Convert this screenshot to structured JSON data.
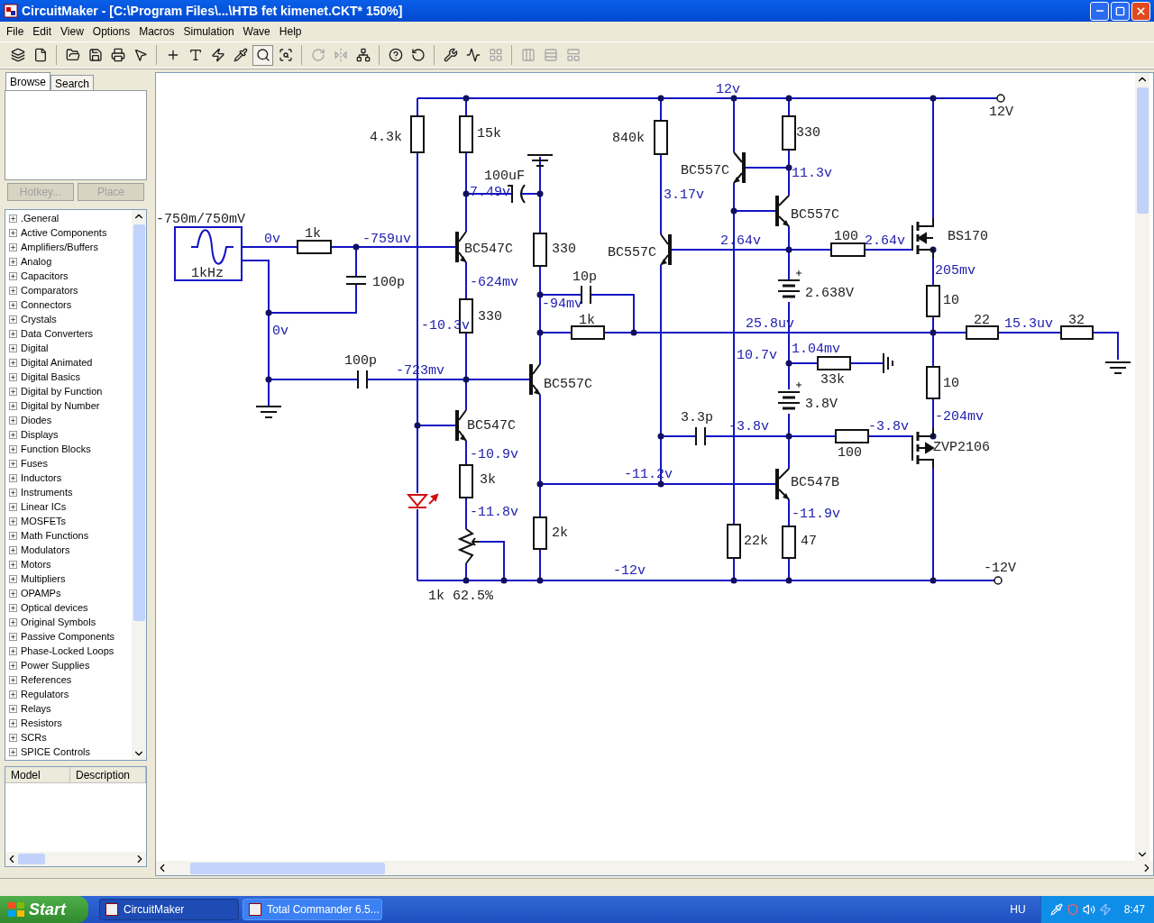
{
  "window": {
    "title": "CircuitMaker - [C:\\Program Files\\...\\HTB fet kimenet.CKT* 150%]"
  },
  "menu": [
    "File",
    "Edit",
    "View",
    "Options",
    "Macros",
    "Simulation",
    "Wave",
    "Help"
  ],
  "toolbar": [
    {
      "selected": false,
      "disabled": false
    },
    {
      "selected": false,
      "disabled": false
    },
    {
      "selected": false,
      "disabled": false
    },
    {
      "selected": false,
      "disabled": false
    },
    {
      "selected": false,
      "disabled": false
    },
    {
      "selected": false,
      "disabled": false
    },
    {
      "selected": false,
      "disabled": false
    },
    {
      "selected": false,
      "disabled": false
    },
    {
      "selected": false,
      "disabled": false
    },
    {
      "selected": false,
      "disabled": false
    },
    {
      "selected": true,
      "disabled": false
    },
    {
      "selected": false,
      "disabled": false
    },
    {
      "selected": false,
      "disabled": true
    },
    {
      "selected": false,
      "disabled": true
    },
    {
      "selected": false,
      "disabled": false
    },
    {
      "selected": false,
      "disabled": false
    },
    {
      "selected": false,
      "disabled": false
    },
    {
      "selected": false,
      "disabled": false
    },
    {
      "selected": false,
      "disabled": false
    },
    {
      "selected": false,
      "disabled": true
    },
    {
      "selected": false,
      "disabled": true
    },
    {
      "selected": false,
      "disabled": true
    },
    {
      "selected": false,
      "disabled": true
    }
  ],
  "sidebar": {
    "tabs": [
      {
        "label": "Browse",
        "selected": true
      },
      {
        "label": "Search",
        "selected": false
      }
    ],
    "buttons": [
      {
        "label": "Hotkey...",
        "disabled": true
      },
      {
        "label": "Place",
        "disabled": true
      }
    ],
    "library": [
      {
        "label": ".General",
        "expanded": false
      },
      {
        "label": "Active Components",
        "expanded": false
      },
      {
        "label": "Amplifiers/Buffers",
        "expanded": false
      },
      {
        "label": "Analog",
        "expanded": false
      },
      {
        "label": "Capacitors",
        "expanded": false
      },
      {
        "label": "Comparators",
        "expanded": false
      },
      {
        "label": "Connectors",
        "expanded": false
      },
      {
        "label": "Crystals",
        "expanded": false
      },
      {
        "label": "Data Converters",
        "expanded": false
      },
      {
        "label": "Digital",
        "expanded": false
      },
      {
        "label": "Digital Animated",
        "expanded": false
      },
      {
        "label": "Digital Basics",
        "expanded": false
      },
      {
        "label": "Digital by Function",
        "expanded": false
      },
      {
        "label": "Digital by Number",
        "expanded": false
      },
      {
        "label": "Diodes",
        "expanded": false
      },
      {
        "label": "Displays",
        "expanded": false
      },
      {
        "label": "Function Blocks",
        "expanded": false
      },
      {
        "label": "Fuses",
        "expanded": false
      },
      {
        "label": "Inductors",
        "expanded": false
      },
      {
        "label": "Instruments",
        "expanded": false
      },
      {
        "label": "Linear ICs",
        "expanded": false
      },
      {
        "label": "MOSFETs",
        "expanded": false
      },
      {
        "label": "Math Functions",
        "expanded": false
      },
      {
        "label": "Modulators",
        "expanded": false
      },
      {
        "label": "Motors",
        "expanded": false
      },
      {
        "label": "Multipliers",
        "expanded": false
      },
      {
        "label": "OPAMPs",
        "expanded": false
      },
      {
        "label": "Optical devices",
        "expanded": false
      },
      {
        "label": "Original Symbols",
        "expanded": false
      },
      {
        "label": "Passive Components",
        "expanded": false
      },
      {
        "label": "Phase-Locked Loops",
        "expanded": false
      },
      {
        "label": "Power Supplies",
        "expanded": false
      },
      {
        "label": "References",
        "expanded": false
      },
      {
        "label": "Regulators",
        "expanded": false
      },
      {
        "label": "Relays",
        "expanded": false
      },
      {
        "label": "Resistors",
        "expanded": false
      },
      {
        "label": "SCRs",
        "expanded": false
      },
      {
        "label": "SPICE Controls",
        "expanded": false
      }
    ],
    "table_columns": [
      "Model",
      "Description"
    ]
  },
  "schematic": {
    "labels": [
      {
        "text": "-750m/750mV",
        "kind": "part"
      },
      {
        "text": "1kHz",
        "kind": "part"
      },
      {
        "text": "1k",
        "kind": "part"
      },
      {
        "text": "100p",
        "kind": "part"
      },
      {
        "text": "100p",
        "kind": "part"
      },
      {
        "text": "4.3k",
        "kind": "part"
      },
      {
        "text": "15k",
        "kind": "part"
      },
      {
        "text": "100uF",
        "kind": "part"
      },
      {
        "text": "BC547C",
        "kind": "part"
      },
      {
        "text": "330",
        "kind": "part"
      },
      {
        "text": "330",
        "kind": "part"
      },
      {
        "text": "BC547C",
        "kind": "part"
      },
      {
        "text": "3k",
        "kind": "part"
      },
      {
        "text": "1k 62.5%",
        "kind": "part"
      },
      {
        "text": "10p",
        "kind": "part"
      },
      {
        "text": "1k",
        "kind": "part"
      },
      {
        "text": "BC557C",
        "kind": "part"
      },
      {
        "text": "2k",
        "kind": "part"
      },
      {
        "text": "840k",
        "kind": "part"
      },
      {
        "text": "BC557C",
        "kind": "part"
      },
      {
        "text": "BC557C",
        "kind": "part"
      },
      {
        "text": "330",
        "kind": "part"
      },
      {
        "text": "BC557C",
        "kind": "part"
      },
      {
        "text": "100",
        "kind": "part"
      },
      {
        "text": "BS170",
        "kind": "part"
      },
      {
        "text": "2.638V",
        "kind": "part"
      },
      {
        "text": "10",
        "kind": "part"
      },
      {
        "text": "22",
        "kind": "part"
      },
      {
        "text": "32",
        "kind": "part"
      },
      {
        "text": "12V",
        "kind": "part"
      },
      {
        "text": "33k",
        "kind": "part"
      },
      {
        "text": "3.8V",
        "kind": "part"
      },
      {
        "text": "10",
        "kind": "part"
      },
      {
        "text": "3.3p",
        "kind": "part"
      },
      {
        "text": "100",
        "kind": "part"
      },
      {
        "text": "ZVP2106",
        "kind": "part"
      },
      {
        "text": "BC547B",
        "kind": "part"
      },
      {
        "text": "22k",
        "kind": "part"
      },
      {
        "text": "47",
        "kind": "part"
      },
      {
        "text": "-12V",
        "kind": "part"
      },
      {
        "text": "0v",
        "kind": "probe"
      },
      {
        "text": "-759uv",
        "kind": "probe"
      },
      {
        "text": "0v",
        "kind": "probe"
      },
      {
        "text": "7.49v",
        "kind": "probe"
      },
      {
        "text": "-624mv",
        "kind": "probe"
      },
      {
        "text": "-10.3v",
        "kind": "probe"
      },
      {
        "text": "-94mv",
        "kind": "probe"
      },
      {
        "text": "-723mv",
        "kind": "probe"
      },
      {
        "text": "-10.9v",
        "kind": "probe"
      },
      {
        "text": "-11.8v",
        "kind": "probe"
      },
      {
        "text": "12v",
        "kind": "probe"
      },
      {
        "text": "3.17v",
        "kind": "probe"
      },
      {
        "text": "11.3v",
        "kind": "probe"
      },
      {
        "text": "2.64v",
        "kind": "probe"
      },
      {
        "text": "2.64v",
        "kind": "probe"
      },
      {
        "text": "205mv",
        "kind": "probe"
      },
      {
        "text": "25.8uv",
        "kind": "probe"
      },
      {
        "text": "15.3uv",
        "kind": "probe"
      },
      {
        "text": "10.7v",
        "kind": "probe"
      },
      {
        "text": "1.04mv",
        "kind": "probe"
      },
      {
        "text": "-3.8v",
        "kind": "probe"
      },
      {
        "text": "-3.8v",
        "kind": "probe"
      },
      {
        "text": "-204mv",
        "kind": "probe"
      },
      {
        "text": "-11.2v",
        "kind": "probe"
      },
      {
        "text": "-11.9v",
        "kind": "probe"
      },
      {
        "text": "-12v",
        "kind": "probe"
      }
    ]
  },
  "taskbar": {
    "start": "Start",
    "tasks": [
      {
        "label": "CircuitMaker",
        "selected": true
      },
      {
        "label": "Total Commander 6.5...",
        "selected": false
      }
    ],
    "language": "HU",
    "clock": "8:47"
  }
}
